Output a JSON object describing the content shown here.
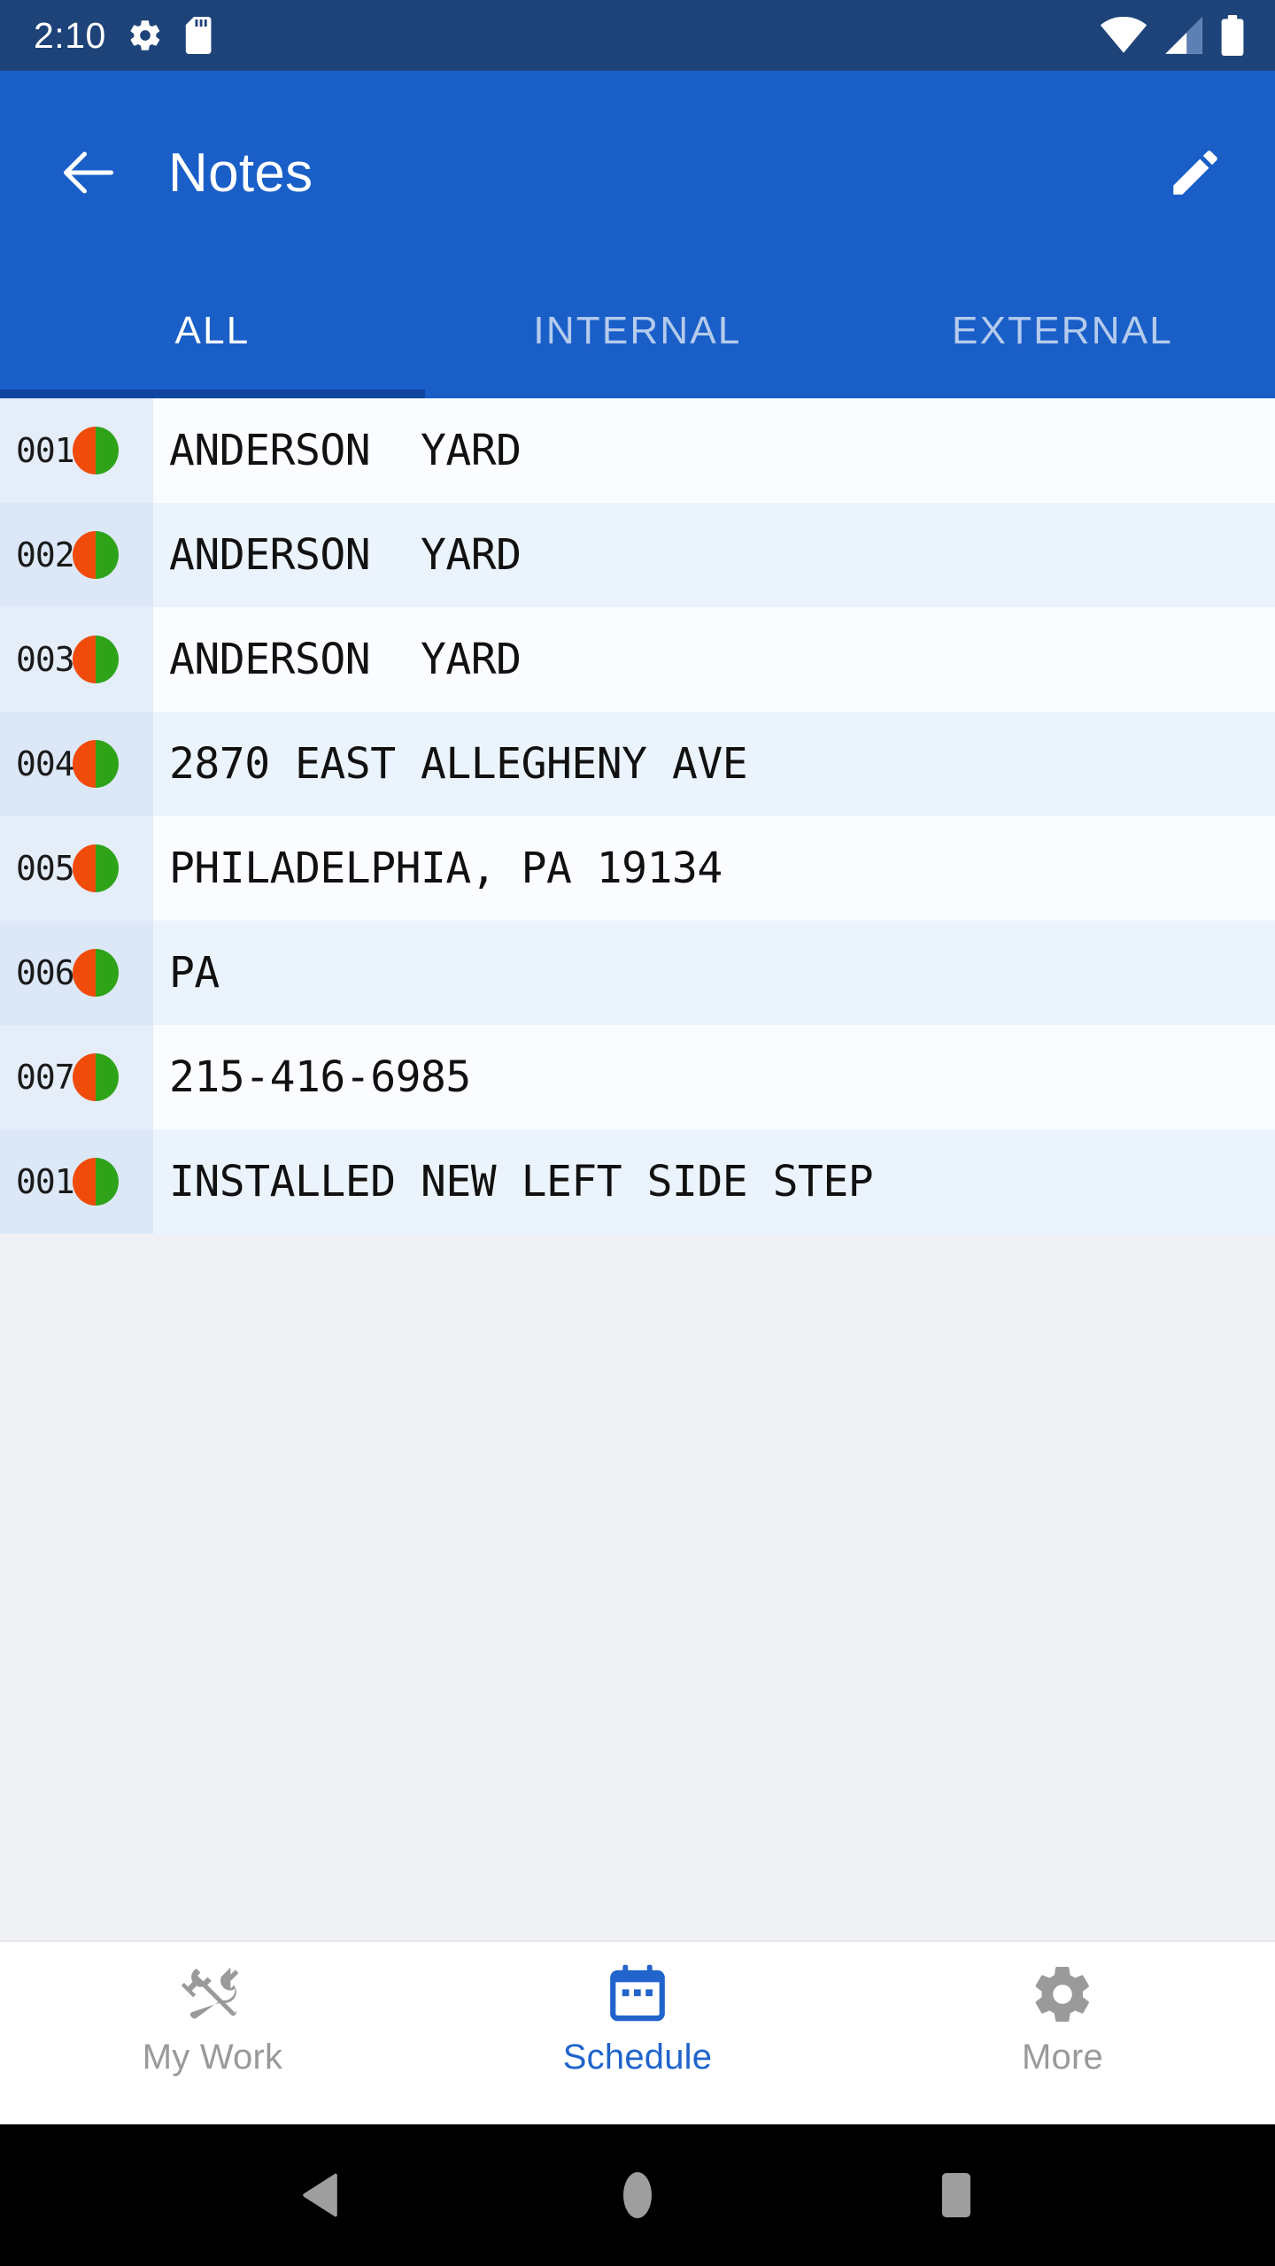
{
  "status_bar": {
    "time": "2:10",
    "icons_left": [
      "gear-icon",
      "sd-card-icon"
    ],
    "icons_right": [
      "wifi-icon",
      "cellular-signal-icon",
      "battery-icon"
    ],
    "background_color": "#1E4379"
  },
  "app_bar": {
    "title": "Notes",
    "back_icon": "back-arrow-icon",
    "edit_icon": "pencil-edit-icon",
    "background_color": "#1A5FC8"
  },
  "tabs": {
    "active_index": 0,
    "indicator_color": "#1146A0",
    "items": [
      {
        "label": "ALL"
      },
      {
        "label": "INTERNAL"
      },
      {
        "label": "EXTERNAL"
      }
    ]
  },
  "notes_list": {
    "status_dot_left_color": "#F04B0B",
    "status_dot_right_color": "#2FA318",
    "rows": [
      {
        "number": "001",
        "text": "ANDERSON  YARD"
      },
      {
        "number": "002",
        "text": "ANDERSON  YARD"
      },
      {
        "number": "003",
        "text": "ANDERSON  YARD"
      },
      {
        "number": "004",
        "text": "2870 EAST ALLEGHENY AVE"
      },
      {
        "number": "005",
        "text": "PHILADELPHIA, PA 19134"
      },
      {
        "number": "006",
        "text": "PA"
      },
      {
        "number": "007",
        "text": "215-416-6985"
      },
      {
        "number": "001",
        "text": "INSTALLED NEW LEFT SIDE STEP"
      }
    ]
  },
  "bottom_nav": {
    "active_index": 1,
    "active_color": "#2064CC",
    "inactive_color": "#9A9A9A",
    "items": [
      {
        "label": "My Work",
        "icon": "tools-icon"
      },
      {
        "label": "Schedule",
        "icon": "calendar-icon"
      },
      {
        "label": "More",
        "icon": "gear-icon"
      }
    ]
  },
  "system_nav": {
    "items": [
      {
        "icon": "back-triangle-icon"
      },
      {
        "icon": "home-circle-icon"
      },
      {
        "icon": "recents-square-icon"
      }
    ]
  }
}
